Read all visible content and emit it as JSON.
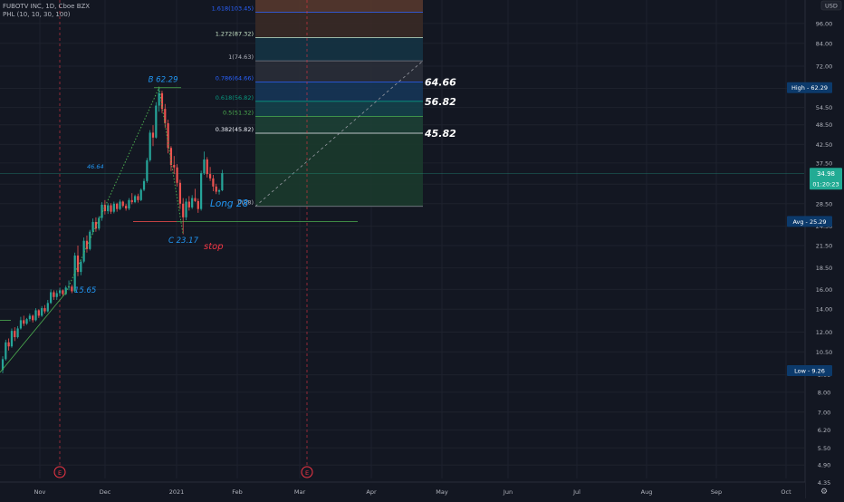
{
  "chart_data": {
    "type": "candlestick",
    "title": "FUBOTV INC, 1D, Cboe BZX",
    "indicator": "PHL (10, 10, 30, 100)",
    "currency": "USD",
    "x_ticks": [
      "Nov",
      "Dec",
      "2021",
      "Feb",
      "Mar",
      "Apr",
      "May",
      "Jun",
      "Jul",
      "Aug",
      "Sep",
      "Oct"
    ],
    "y_ticks": [
      "4.35",
      "4.90",
      "5.50",
      "6.20",
      "7.00",
      "8.00",
      "9.00",
      "10.50",
      "12.00",
      "14.00",
      "16.00",
      "18.50",
      "21.50",
      "24.50",
      "28.50",
      "32.50",
      "37.50",
      "42.50",
      "48.50",
      "54.50",
      "62.00",
      "72.00",
      "84.00",
      "96.00"
    ],
    "y_scale": "log",
    "candles_ohlc": [
      [
        9.3,
        10.2,
        9.1,
        10.0
      ],
      [
        10.0,
        11.4,
        9.9,
        11.2
      ],
      [
        11.2,
        11.5,
        10.6,
        10.9
      ],
      [
        10.9,
        12.3,
        10.8,
        12.1
      ],
      [
        12.1,
        12.4,
        11.3,
        11.6
      ],
      [
        11.6,
        12.5,
        11.5,
        12.3
      ],
      [
        12.3,
        13.3,
        12.2,
        13.0
      ],
      [
        13.0,
        13.4,
        12.5,
        12.7
      ],
      [
        12.7,
        13.2,
        12.6,
        13.1
      ],
      [
        13.1,
        13.6,
        12.9,
        13.4
      ],
      [
        13.4,
        13.5,
        12.8,
        13.0
      ],
      [
        13.0,
        14.1,
        12.9,
        13.9
      ],
      [
        13.9,
        14.0,
        13.2,
        13.4
      ],
      [
        13.4,
        14.3,
        13.3,
        14.1
      ],
      [
        14.1,
        14.4,
        13.6,
        13.8
      ],
      [
        13.8,
        14.9,
        13.7,
        14.6
      ],
      [
        14.6,
        16.0,
        14.5,
        15.7
      ],
      [
        15.7,
        15.9,
        14.9,
        15.2
      ],
      [
        15.2,
        15.9,
        14.9,
        15.6
      ],
      [
        15.6,
        16.2,
        15.3,
        15.9
      ],
      [
        15.9,
        16.0,
        15.3,
        15.5
      ],
      [
        15.5,
        16.4,
        15.4,
        16.2
      ],
      [
        16.2,
        17.0,
        15.9,
        16.3
      ],
      [
        16.3,
        16.5,
        15.6,
        15.8
      ],
      [
        15.8,
        20.5,
        15.7,
        20.1
      ],
      [
        20.1,
        21.5,
        17.5,
        18.0
      ],
      [
        18.0,
        19.6,
        17.6,
        19.3
      ],
      [
        19.3,
        22.7,
        19.1,
        22.2
      ],
      [
        22.2,
        23.0,
        20.5,
        21.0
      ],
      [
        21.0,
        23.9,
        20.8,
        23.6
      ],
      [
        23.6,
        25.8,
        23.2,
        25.2
      ],
      [
        25.2,
        26.0,
        23.6,
        24.1
      ],
      [
        24.1,
        26.2,
        23.8,
        25.9
      ],
      [
        25.9,
        28.8,
        25.4,
        28.3
      ],
      [
        28.3,
        29.2,
        26.5,
        27.1
      ],
      [
        27.1,
        28.6,
        26.6,
        28.2
      ],
      [
        28.2,
        28.6,
        26.6,
        27.0
      ],
      [
        27.0,
        28.9,
        26.7,
        28.5
      ],
      [
        28.5,
        28.7,
        27.0,
        27.5
      ],
      [
        27.5,
        29.3,
        27.3,
        28.9
      ],
      [
        28.9,
        29.1,
        27.8,
        28.1
      ],
      [
        28.1,
        28.5,
        27.2,
        27.6
      ],
      [
        27.6,
        29.6,
        27.3,
        29.2
      ],
      [
        29.2,
        30.6,
        28.4,
        28.8
      ],
      [
        28.8,
        30.3,
        28.6,
        30.0
      ],
      [
        30.0,
        30.5,
        28.7,
        29.2
      ],
      [
        29.2,
        31.6,
        29.0,
        31.3
      ],
      [
        31.3,
        33.8,
        31.0,
        33.2
      ],
      [
        33.2,
        38.8,
        32.8,
        38.2
      ],
      [
        38.2,
        46.8,
        37.8,
        46.0
      ],
      [
        46.0,
        48.4,
        42.0,
        44.5
      ],
      [
        44.5,
        56.5,
        44.2,
        55.2
      ],
      [
        55.2,
        62.3,
        53.0,
        60.0
      ],
      [
        60.0,
        61.0,
        52.5,
        54.0
      ],
      [
        54.0,
        55.8,
        47.5,
        49.0
      ],
      [
        49.0,
        50.2,
        40.0,
        41.5
      ],
      [
        41.5,
        42.0,
        35.5,
        37.0
      ],
      [
        37.0,
        39.3,
        34.8,
        36.4
      ],
      [
        36.4,
        37.2,
        32.0,
        32.8
      ],
      [
        32.8,
        33.5,
        27.5,
        28.5
      ],
      [
        28.5,
        29.6,
        23.2,
        26.0
      ],
      [
        26.0,
        29.5,
        25.5,
        28.9
      ],
      [
        28.9,
        30.0,
        27.2,
        27.8
      ],
      [
        27.8,
        30.2,
        27.5,
        29.6
      ],
      [
        29.6,
        31.5,
        28.8,
        29.0
      ],
      [
        29.0,
        29.5,
        26.8,
        27.5
      ],
      [
        27.5,
        35.6,
        27.2,
        35.0
      ],
      [
        35.0,
        40.5,
        34.6,
        38.4
      ],
      [
        38.4,
        39.0,
        34.0,
        34.8
      ],
      [
        34.8,
        36.5,
        33.2,
        33.8
      ],
      [
        33.8,
        34.6,
        31.0,
        32.0
      ],
      [
        32.0,
        32.6,
        30.4,
        30.9
      ],
      [
        30.9,
        31.5,
        30.3,
        31.2
      ],
      [
        31.2,
        35.8,
        31.0,
        35.0
      ]
    ],
    "fib_levels": [
      {
        "ratio_label": "0(28)",
        "price": 28.0,
        "color": "#787b86"
      },
      {
        "ratio_label": "0.382(45.82)",
        "price": 45.82,
        "color": "#f0f3fa"
      },
      {
        "ratio_label": "0.5(51.32)",
        "price": 51.32,
        "color": "#4caf50"
      },
      {
        "ratio_label": "0.618(56.82)",
        "price": 56.82,
        "color": "#089981"
      },
      {
        "ratio_label": "0.786(64.66)",
        "price": 64.66,
        "color": "#2962ff"
      },
      {
        "ratio_label": "1(74.63)",
        "price": 74.63,
        "color": "#787b86"
      },
      {
        "ratio_label": "1.272(87.32)",
        "price": 87.32,
        "color": "#c8e6c9"
      },
      {
        "ratio_label": "1.618(103.45)",
        "price": 103.45,
        "color": "#2962ff"
      }
    ],
    "target_labels": [
      "64.66",
      "56.82",
      "45.82"
    ],
    "annotations": {
      "point_b": "B 62.29",
      "point_c": "C 23.17",
      "point_a": "15.65",
      "long": "Long 28",
      "stop": "stop",
      "level_label": "46.64"
    },
    "price_badges": {
      "high": "High - 62.29",
      "last": "34.98",
      "countdown": "01:20:23",
      "avg": "Avg - 25.29",
      "low": "Low - 9.26"
    },
    "earnings_marker": "E",
    "colors": {
      "background": "#131722",
      "up": "#26a69a",
      "down": "#ef5350",
      "grid": "#1e222d",
      "text": "#b2b5be",
      "annotation_blue": "#2196f3",
      "stop_red": "#f23645",
      "badge_bg": "#2a2e39",
      "badge_last": "#22ab94",
      "badge_navy": "#0c3a6b"
    }
  }
}
